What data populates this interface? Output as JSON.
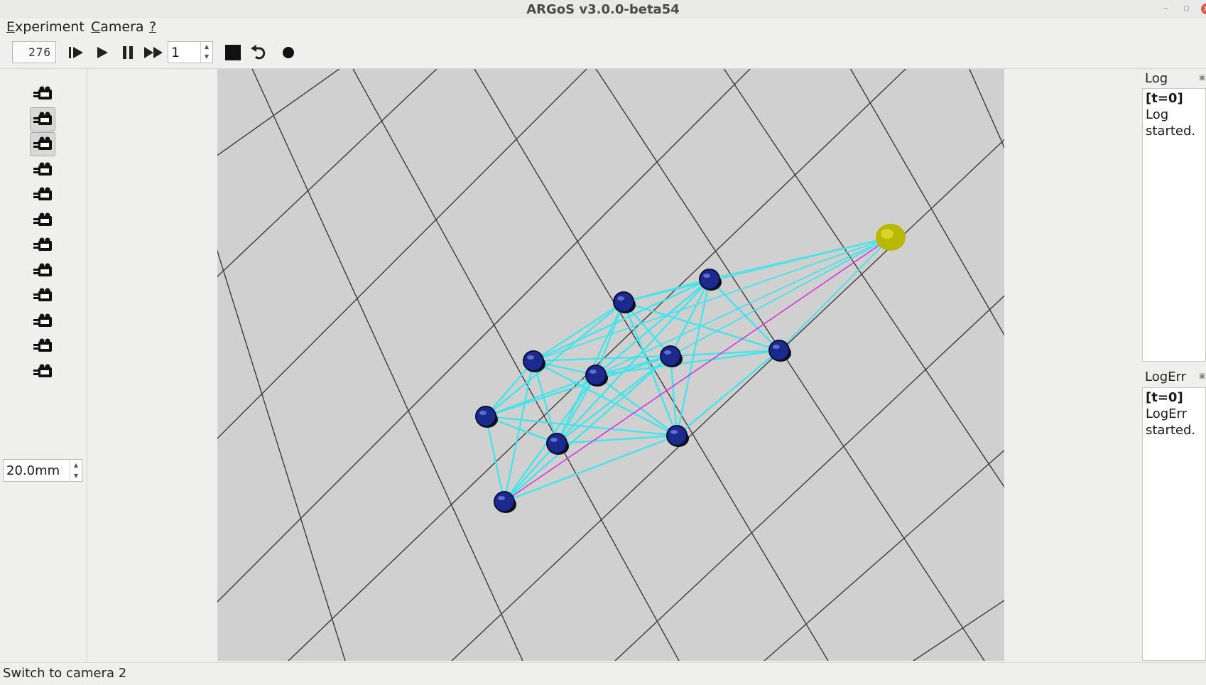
{
  "window": {
    "title": "ARGoS v3.0.0-beta54"
  },
  "menu": [
    {
      "accel": "E",
      "rest": "xperiment"
    },
    {
      "accel": "C",
      "rest": "amera"
    },
    {
      "accel": "?",
      "rest": ""
    }
  ],
  "toolbar": {
    "step_counter": "276",
    "step_spin_value": "1",
    "buttons": [
      "step-icon",
      "play-icon",
      "pause-icon",
      "fast-forward-icon",
      "stop-icon",
      "reset-icon",
      "record-icon"
    ]
  },
  "camera_panel": {
    "camera_count": 12,
    "selected_camera": 2,
    "focal_length": "20.0mm"
  },
  "log": {
    "title": "Log",
    "time_tag": "[t=0]",
    "message": "Log started."
  },
  "logerr": {
    "title": "LogErr",
    "time_tag": "[t=0]",
    "message": "LogErr started."
  },
  "status": {
    "text": "Switch to camera 2"
  },
  "colors": {
    "floor": "#d0d0d0",
    "grid_line": "#3c3c3c",
    "link": "#3fe4ea",
    "target_link": "#d62fd6",
    "robot": "#1b2a8c",
    "target": "#b8b800"
  }
}
